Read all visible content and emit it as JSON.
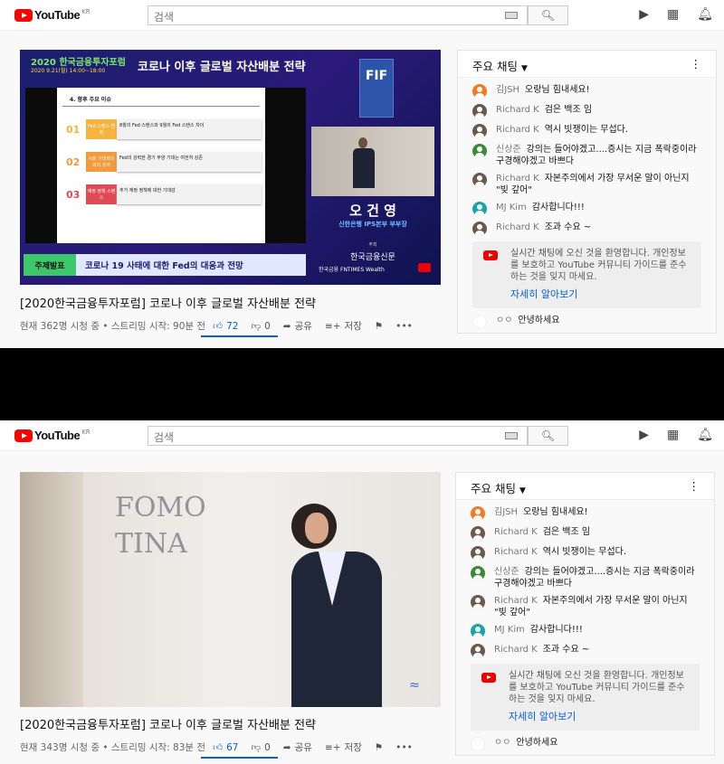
{
  "header": {
    "logo_text": "YouTube",
    "region": "KR",
    "search_placeholder": "검색",
    "icons": [
      "keyboard-icon",
      "search-icon",
      "create-video-icon",
      "apps-grid-icon",
      "notifications-bell-icon"
    ]
  },
  "video_top": {
    "forum_name": "2020 한국금융투자포럼",
    "forum_date": "2020 9.21(월) 14:00~18:00",
    "headline": "코로나 이후 글로벌 자산배분 전략",
    "slide_heading": "4. 향후 주요 이슈",
    "slide_items": [
      {
        "num": "01",
        "tag": "Fed 스탠스 변화",
        "color": "#f6b33d",
        "text": "8월의 Fed 스탠스와 9월의 Fed 스탠스 차이"
      },
      {
        "num": "02",
        "tag": "시장 기대와의 괴리 유의",
        "color": "#f39a3a",
        "text": "Fed의 강력한 경기 부양 기대는 여전히 상존"
      },
      {
        "num": "03",
        "tag": "재정 정책 스탠스",
        "color": "#e04a55",
        "text": "추가 재정 정책에 대한 기대감"
      }
    ],
    "speaker_name": "오 건 영",
    "speaker_title": "신한은행 IPS본부 부부장",
    "topic_label": "주제발표",
    "topic": "코로나 19 사태에 대한 Fed의 대응과 전망",
    "host_label": "주최",
    "host": "한국금융신문",
    "sponsors": "한국금융 FNTIMES Wealth"
  },
  "screens": [
    {
      "title": "[2020한국금융투자포럼] 코로나 이후 글로벌 자산배분 전략",
      "viewers": "현재 362명 시청 중 • 스트리밍 시작: 90분 전",
      "likes": "72",
      "dislikes": "0",
      "share": "공유",
      "save": "저장"
    },
    {
      "title": "[2020한국금융투자포럼] 코로나 이후 글로벌 자산배분 전략",
      "viewers": "현재 343명 시청 중 • 스트리밍 시작: 83분 전",
      "likes": "67",
      "dislikes": "0",
      "share": "공유",
      "save": "저장"
    }
  ],
  "chat": {
    "header": "주요 채팅",
    "messages": [
      {
        "author": "김JSH",
        "text": "오랑님 힘내세요!",
        "avatar": "#ef7b22"
      },
      {
        "author": "Richard K",
        "text": "검은 백조 임",
        "avatar": "#6b5a4a"
      },
      {
        "author": "Richard K",
        "text": "역시 빗쟁이는 무섭다.",
        "avatar": "#6b5a4a"
      },
      {
        "author": "신상준",
        "text": "강의는 들어야겠고....증시는 지금 폭락중이라 구경해야겠고 바쁘다",
        "avatar": "#3a8a3a"
      },
      {
        "author": "Richard K",
        "text": "자본주의에서 가장 무서운 말이 아닌지 \"빚 갚어\"",
        "avatar": "#6b5a4a"
      },
      {
        "author": "MJ Kim",
        "text": "감사합니다!!!",
        "avatar": "#1aa3a8"
      },
      {
        "author": "Richard K",
        "text": "조과 수요 ~",
        "avatar": "#6b5a4a"
      }
    ],
    "welcome": "실시간 채팅에 오신 것을 환영합니다. 개인정보를 보호하고 YouTube 커뮤니티 가이드를 준수하는 것을 잊지 마세요.",
    "learn_more": "자세히 알아보기",
    "input_author": "ㅇㅇ",
    "input_text": "안녕하세요"
  },
  "whiteboard_text": "FOMO TINA"
}
